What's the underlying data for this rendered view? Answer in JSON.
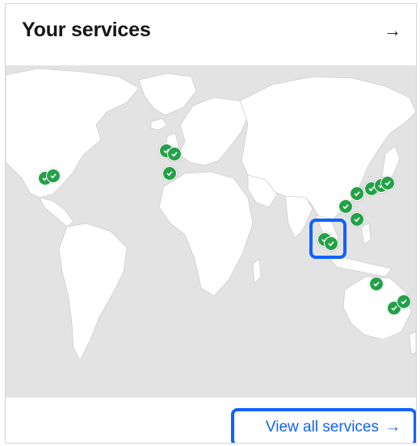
{
  "card": {
    "title": "Your services",
    "header_arrow": "→",
    "view_all_label": "View all services",
    "view_all_arrow": "→"
  },
  "icons": {
    "header_arrow": "arrow-right-icon",
    "view_all_arrow": "arrow-right-icon",
    "marker": "checkmark-filled-icon"
  },
  "colors": {
    "map_bg": "#e3e3e3",
    "land": "#ffffff",
    "marker": "#24a148",
    "highlight": "#0f62fe",
    "link": "#0f62fe"
  },
  "map": {
    "service_location_count": 14,
    "highlighted_marker": "southeast-asia"
  }
}
